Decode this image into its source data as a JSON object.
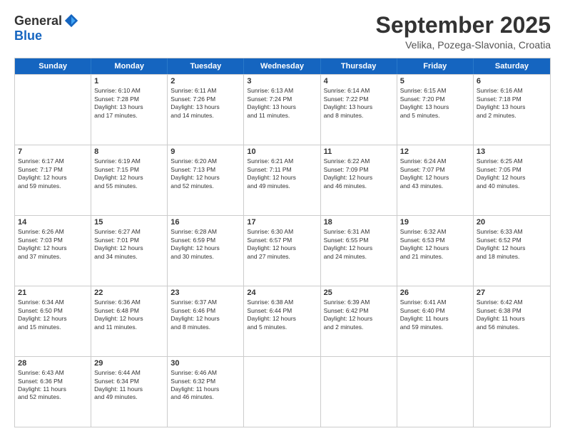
{
  "header": {
    "logo_general": "General",
    "logo_blue": "Blue",
    "month_title": "September 2025",
    "location": "Velika, Pozega-Slavonia, Croatia"
  },
  "weekdays": [
    "Sunday",
    "Monday",
    "Tuesday",
    "Wednesday",
    "Thursday",
    "Friday",
    "Saturday"
  ],
  "rows": [
    [
      {
        "day": "",
        "info": ""
      },
      {
        "day": "1",
        "info": "Sunrise: 6:10 AM\nSunset: 7:28 PM\nDaylight: 13 hours\nand 17 minutes."
      },
      {
        "day": "2",
        "info": "Sunrise: 6:11 AM\nSunset: 7:26 PM\nDaylight: 13 hours\nand 14 minutes."
      },
      {
        "day": "3",
        "info": "Sunrise: 6:13 AM\nSunset: 7:24 PM\nDaylight: 13 hours\nand 11 minutes."
      },
      {
        "day": "4",
        "info": "Sunrise: 6:14 AM\nSunset: 7:22 PM\nDaylight: 13 hours\nand 8 minutes."
      },
      {
        "day": "5",
        "info": "Sunrise: 6:15 AM\nSunset: 7:20 PM\nDaylight: 13 hours\nand 5 minutes."
      },
      {
        "day": "6",
        "info": "Sunrise: 6:16 AM\nSunset: 7:18 PM\nDaylight: 13 hours\nand 2 minutes."
      }
    ],
    [
      {
        "day": "7",
        "info": "Sunrise: 6:17 AM\nSunset: 7:17 PM\nDaylight: 12 hours\nand 59 minutes."
      },
      {
        "day": "8",
        "info": "Sunrise: 6:19 AM\nSunset: 7:15 PM\nDaylight: 12 hours\nand 55 minutes."
      },
      {
        "day": "9",
        "info": "Sunrise: 6:20 AM\nSunset: 7:13 PM\nDaylight: 12 hours\nand 52 minutes."
      },
      {
        "day": "10",
        "info": "Sunrise: 6:21 AM\nSunset: 7:11 PM\nDaylight: 12 hours\nand 49 minutes."
      },
      {
        "day": "11",
        "info": "Sunrise: 6:22 AM\nSunset: 7:09 PM\nDaylight: 12 hours\nand 46 minutes."
      },
      {
        "day": "12",
        "info": "Sunrise: 6:24 AM\nSunset: 7:07 PM\nDaylight: 12 hours\nand 43 minutes."
      },
      {
        "day": "13",
        "info": "Sunrise: 6:25 AM\nSunset: 7:05 PM\nDaylight: 12 hours\nand 40 minutes."
      }
    ],
    [
      {
        "day": "14",
        "info": "Sunrise: 6:26 AM\nSunset: 7:03 PM\nDaylight: 12 hours\nand 37 minutes."
      },
      {
        "day": "15",
        "info": "Sunrise: 6:27 AM\nSunset: 7:01 PM\nDaylight: 12 hours\nand 34 minutes."
      },
      {
        "day": "16",
        "info": "Sunrise: 6:28 AM\nSunset: 6:59 PM\nDaylight: 12 hours\nand 30 minutes."
      },
      {
        "day": "17",
        "info": "Sunrise: 6:30 AM\nSunset: 6:57 PM\nDaylight: 12 hours\nand 27 minutes."
      },
      {
        "day": "18",
        "info": "Sunrise: 6:31 AM\nSunset: 6:55 PM\nDaylight: 12 hours\nand 24 minutes."
      },
      {
        "day": "19",
        "info": "Sunrise: 6:32 AM\nSunset: 6:53 PM\nDaylight: 12 hours\nand 21 minutes."
      },
      {
        "day": "20",
        "info": "Sunrise: 6:33 AM\nSunset: 6:52 PM\nDaylight: 12 hours\nand 18 minutes."
      }
    ],
    [
      {
        "day": "21",
        "info": "Sunrise: 6:34 AM\nSunset: 6:50 PM\nDaylight: 12 hours\nand 15 minutes."
      },
      {
        "day": "22",
        "info": "Sunrise: 6:36 AM\nSunset: 6:48 PM\nDaylight: 12 hours\nand 11 minutes."
      },
      {
        "day": "23",
        "info": "Sunrise: 6:37 AM\nSunset: 6:46 PM\nDaylight: 12 hours\nand 8 minutes."
      },
      {
        "day": "24",
        "info": "Sunrise: 6:38 AM\nSunset: 6:44 PM\nDaylight: 12 hours\nand 5 minutes."
      },
      {
        "day": "25",
        "info": "Sunrise: 6:39 AM\nSunset: 6:42 PM\nDaylight: 12 hours\nand 2 minutes."
      },
      {
        "day": "26",
        "info": "Sunrise: 6:41 AM\nSunset: 6:40 PM\nDaylight: 11 hours\nand 59 minutes."
      },
      {
        "day": "27",
        "info": "Sunrise: 6:42 AM\nSunset: 6:38 PM\nDaylight: 11 hours\nand 56 minutes."
      }
    ],
    [
      {
        "day": "28",
        "info": "Sunrise: 6:43 AM\nSunset: 6:36 PM\nDaylight: 11 hours\nand 52 minutes."
      },
      {
        "day": "29",
        "info": "Sunrise: 6:44 AM\nSunset: 6:34 PM\nDaylight: 11 hours\nand 49 minutes."
      },
      {
        "day": "30",
        "info": "Sunrise: 6:46 AM\nSunset: 6:32 PM\nDaylight: 11 hours\nand 46 minutes."
      },
      {
        "day": "",
        "info": ""
      },
      {
        "day": "",
        "info": ""
      },
      {
        "day": "",
        "info": ""
      },
      {
        "day": "",
        "info": ""
      }
    ]
  ]
}
